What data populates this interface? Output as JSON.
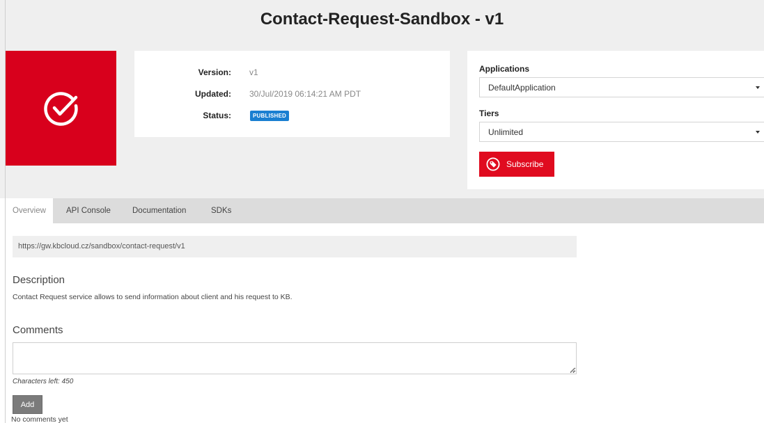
{
  "header": {
    "title": "Contact-Request-Sandbox - v1"
  },
  "logo": {
    "icon": "checkmark-circle-icon",
    "color": "#d8001c"
  },
  "info": {
    "version_label": "Version:",
    "version_value": "v1",
    "updated_label": "Updated:",
    "updated_value": "30/Jul/2019 06:14:21 AM PDT",
    "status_label": "Status:",
    "status_value": "PUBLISHED",
    "status_color": "#1a7fd1"
  },
  "subscription": {
    "applications_label": "Applications",
    "applications_selected": "DefaultApplication",
    "tiers_label": "Tiers",
    "tiers_selected": "Unlimited",
    "subscribe_label": "Subscribe",
    "subscribe_icon": "tag-icon",
    "accent_color": "#e00b1f"
  },
  "tabs": [
    {
      "label": "Overview",
      "active": true
    },
    {
      "label": "API Console",
      "active": false
    },
    {
      "label": "Documentation",
      "active": false
    },
    {
      "label": "SDKs",
      "active": false
    }
  ],
  "overview": {
    "endpoint_url": "https://gw.kbcloud.cz/sandbox/contact-request/v1",
    "description_heading": "Description",
    "description_text": "Contact Request service allows to send information about client and his request to KB.",
    "comments_heading": "Comments",
    "comment_value": "",
    "chars_left": "Characters left: 450",
    "add_label": "Add",
    "no_comments": "No comments yet"
  }
}
